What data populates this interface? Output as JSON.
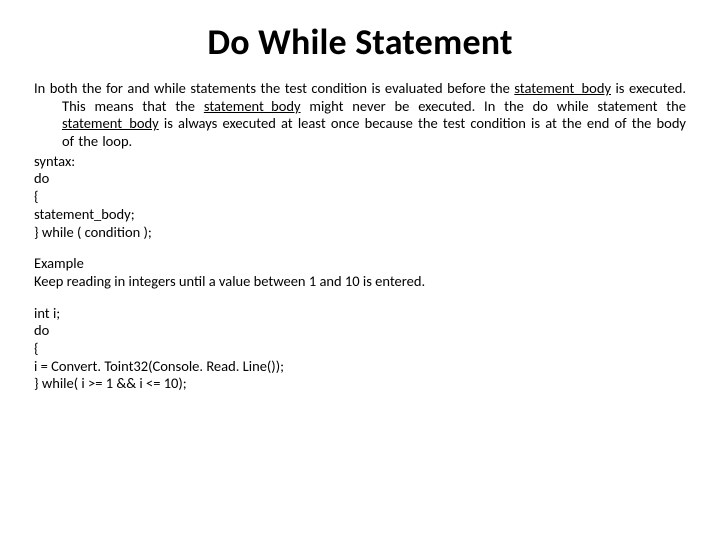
{
  "title": "Do While Statement",
  "intro": {
    "t1": "In both the for and while statements the test condition is evaluated before the ",
    "u1": "statement_body",
    "t2": " is executed. This means that the ",
    "u2": "statement_body",
    "t3": " might never be executed. In the do while statement the ",
    "u3": "statement_body",
    "t4": " is always executed at least once because the test condition is at the end of the body of the loop."
  },
  "syntax": {
    "label": "syntax:",
    "l1": "do",
    "l2": "{",
    "l3": "statement_body;",
    "l4": "} while ( condition );"
  },
  "example": {
    "heading": "Example",
    "desc": "Keep reading in integers until a value between 1 and 10 is entered.",
    "l1": "int i;",
    "l2": "do",
    "l3": "{",
    "l4": "i = Convert. Toint32(Console. Read. Line());",
    "l5": "} while( i >= 1 && i <= 10);"
  }
}
